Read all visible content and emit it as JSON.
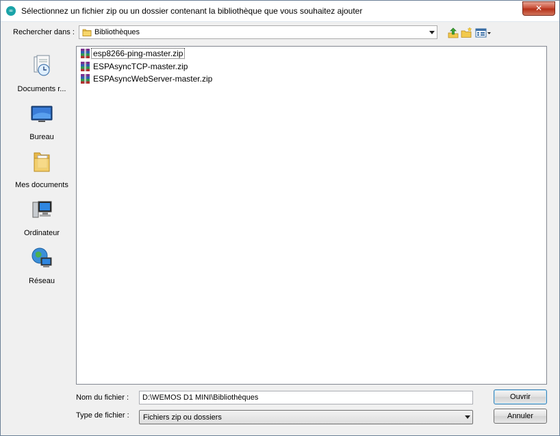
{
  "window": {
    "title": "Sélectionnez un fichier zip ou un dossier contenant la bibliothèque que vous souhaitez ajouter",
    "close_glyph": "✕"
  },
  "lookin": {
    "label": "Rechercher dans :",
    "value": "Bibliothèques"
  },
  "toolbar": {
    "icons": [
      "up-one-level-icon",
      "new-folder-icon",
      "view-menu-icon"
    ]
  },
  "places": [
    {
      "label": "Documents r...",
      "icon": "recent-documents-icon"
    },
    {
      "label": "Bureau",
      "icon": "desktop-icon"
    },
    {
      "label": "Mes documents",
      "icon": "my-documents-icon"
    },
    {
      "label": "Ordinateur",
      "icon": "computer-icon"
    },
    {
      "label": "Réseau",
      "icon": "network-icon"
    }
  ],
  "files": [
    {
      "name": "esp8266-ping-master.zip",
      "icon": "zip-archive-icon"
    },
    {
      "name": "ESPAsyncTCP-master.zip",
      "icon": "zip-archive-icon"
    },
    {
      "name": "ESPAsyncWebServer-master.zip",
      "icon": "zip-archive-icon"
    }
  ],
  "filename": {
    "label": "Nom du fichier :",
    "value": "D:\\WEMOS D1 MINI\\Bibliothèques"
  },
  "filetype": {
    "label": "Type de fichier :",
    "value": "Fichiers zip ou dossiers"
  },
  "buttons": {
    "open": "Ouvrir",
    "cancel": "Annuler"
  },
  "colors": {
    "app_icon": "#1aa3a8",
    "close_button": "#c5462f",
    "folder": "#f2c94c"
  }
}
